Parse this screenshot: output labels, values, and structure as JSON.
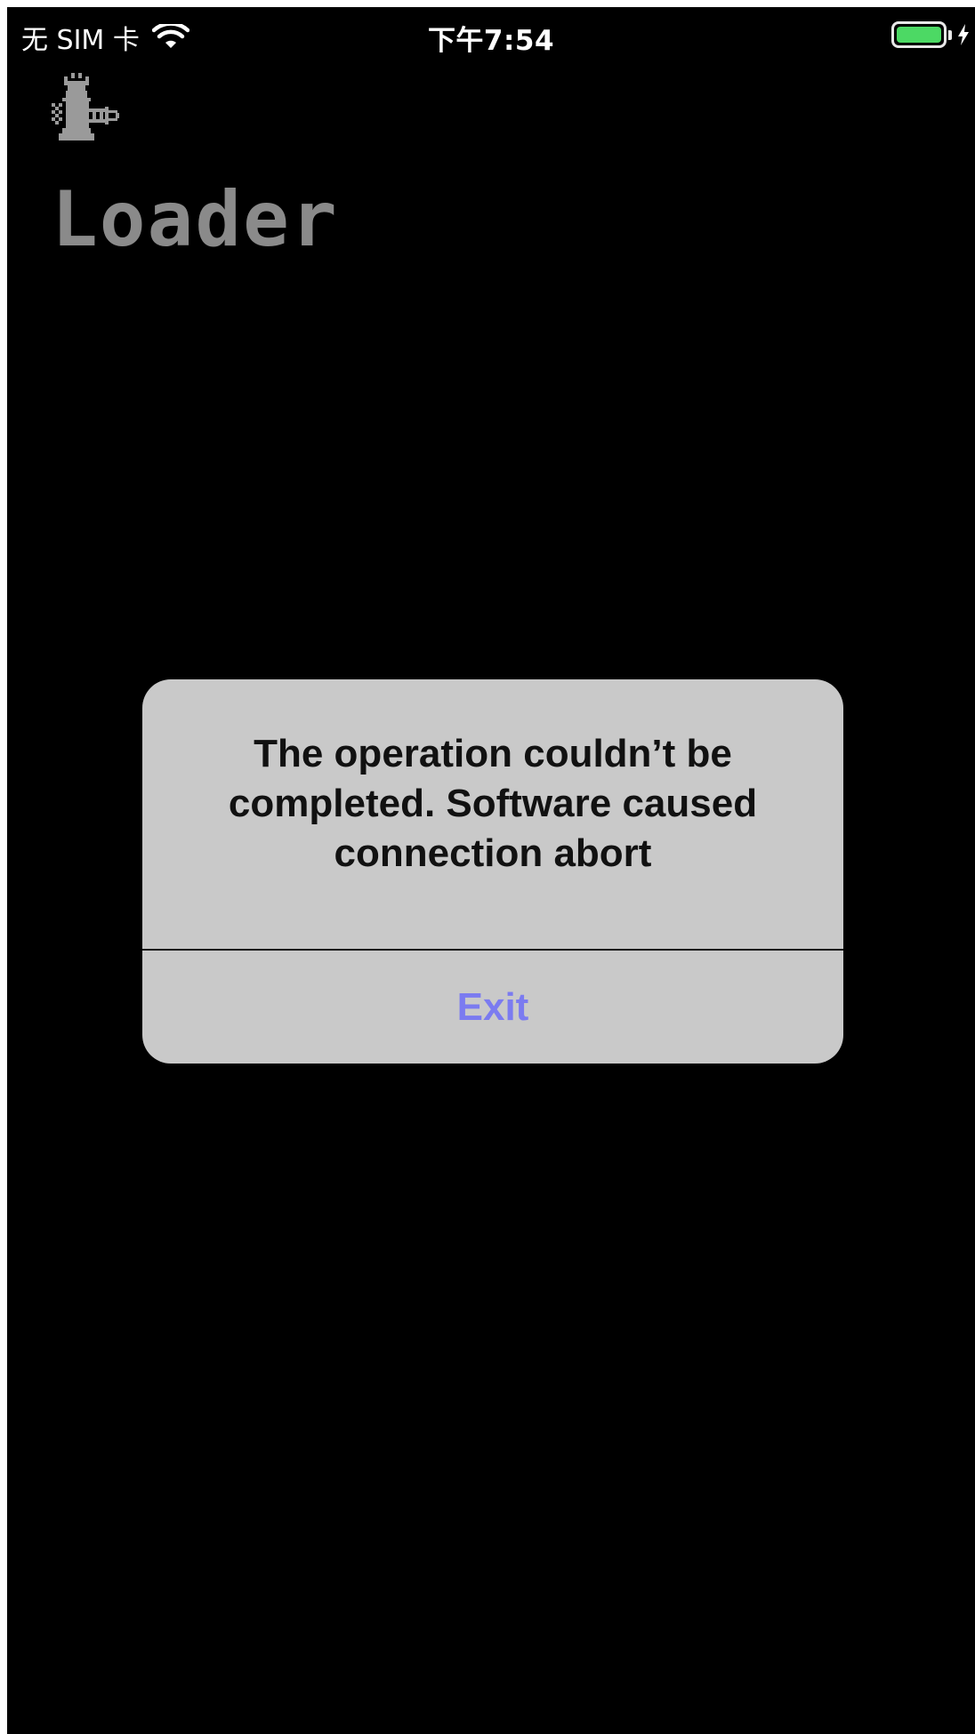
{
  "status_bar": {
    "carrier": "无 SIM 卡",
    "time": "下午7:54",
    "wifi_icon": "wifi-icon",
    "battery_icon": "battery-icon",
    "charging_icon": "charging-bolt-icon",
    "battery_level": 1.0,
    "battery_color": "#4cd964"
  },
  "app": {
    "logo_icon": "chess-rook-logo-icon",
    "title": "Loader",
    "title_color": "#8a8a8a",
    "background": "#000000"
  },
  "alert": {
    "message": "The operation couldn’t be completed. Software caused connection abort",
    "button_label": "Exit",
    "button_color": "#7b7bf0",
    "background": "#c9c9c9"
  }
}
